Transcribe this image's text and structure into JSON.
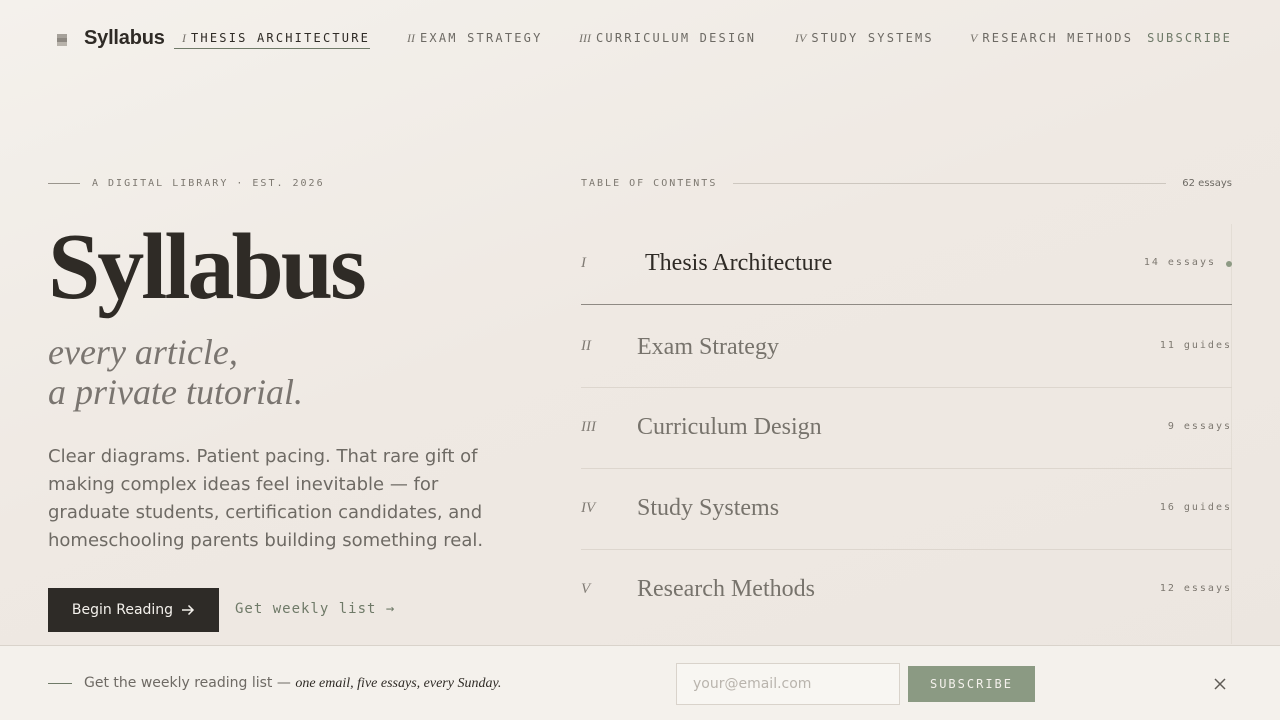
{
  "nav": {
    "logo_text": "Syllabus",
    "items": [
      {
        "num": "I",
        "label": "THESIS ARCHITECTURE"
      },
      {
        "num": "II",
        "label": "EXAM STRATEGY"
      },
      {
        "num": "III",
        "label": "CURRICULUM DESIGN"
      },
      {
        "num": "IV",
        "label": "STUDY SYSTEMS"
      },
      {
        "num": "V",
        "label": "RESEARCH METHODS"
      }
    ],
    "subscribe_label": "SUBSCRIBE",
    "active_index": 0
  },
  "hero": {
    "eyebrow": "A DIGITAL LIBRARY · EST. 2026",
    "title": "Syllabus",
    "tagline_line1": "every article,",
    "tagline_line2": "a private tutorial.",
    "body": "Clear diagrams. Patient pacing. That rare gift of making complex ideas feel inevitable — for graduate students, certification candidates, and homeschooling parents building something real.",
    "primary_cta": "Begin Reading",
    "secondary_cta": "Get weekly list →"
  },
  "toc": {
    "label": "TABLE OF CONTENTS",
    "count": "62 essays",
    "rows": [
      {
        "num": "I",
        "title": "Thesis Architecture",
        "meta": "14 essays"
      },
      {
        "num": "II",
        "title": "Exam Strategy",
        "meta": "11 guides"
      },
      {
        "num": "III",
        "title": "Curriculum Design",
        "meta": "9 essays"
      },
      {
        "num": "IV",
        "title": "Study Systems",
        "meta": "16 guides"
      },
      {
        "num": "V",
        "title": "Research Methods",
        "meta": "12 essays"
      }
    ]
  },
  "newsletter": {
    "text": "Get the weekly reading list —",
    "text_em": "one email, five essays, every Sunday.",
    "email_placeholder": "your@email.com",
    "email_value": "",
    "button_label": "SUBSCRIBE"
  },
  "icons": {
    "logo": "book-stack-icon",
    "arrow": "arrow-right-icon",
    "close": "close-icon",
    "active_dot": "dot-indicator-icon"
  },
  "colors": {
    "background": "#f1ede8",
    "ink": "#2f2b26",
    "muted": "#6e6a64",
    "accent": "#8b9a83"
  }
}
